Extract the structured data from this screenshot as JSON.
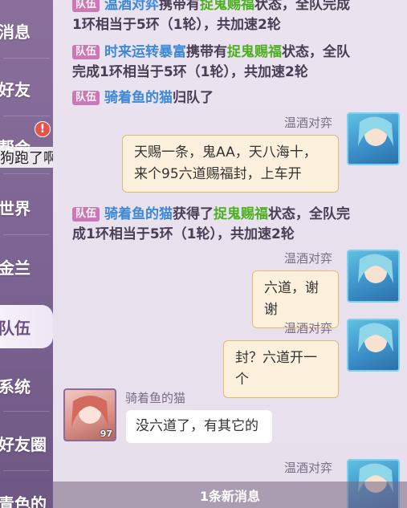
{
  "sidebar": {
    "items": [
      {
        "label": "消息"
      },
      {
        "label": "好友"
      },
      {
        "label": "帮会"
      },
      {
        "label": "世界"
      },
      {
        "label": "金兰"
      },
      {
        "label": "队伍"
      },
      {
        "label": "系统"
      },
      {
        "label": "好友圈"
      },
      {
        "label": "青色的"
      }
    ],
    "active": "队伍",
    "badge": "!",
    "overlay_text": "狗跑了啊"
  },
  "chat": {
    "sys1": {
      "tag": "队伍",
      "name": "温酒对弈",
      "pre": "携带有",
      "buff": "捉鬼赐福",
      "post": "状态，全队完成",
      "line2": "1环相当于5环（1轮），共加速2轮"
    },
    "sys2": {
      "tag": "队伍",
      "name": "时来运转暴富",
      "pre": "携带有",
      "buff": "捉鬼赐福",
      "post": "状态，全队",
      "line2": "完成1环相当于5环（1轮），共加速2轮"
    },
    "sys3": {
      "tag": "队伍",
      "name": "骑着鱼的猫",
      "post": "归队了"
    },
    "msg1": {
      "sender": "温酒对弈",
      "line1": "天赐一条，鬼AA，天八海十，",
      "line2": "来个95六道赐福封，上车开"
    },
    "sys4": {
      "tag": "队伍",
      "name": "骑着鱼的猫",
      "pre": "获得了",
      "buff": "捉鬼赐福",
      "post": "状态，全队完",
      "line2": "成1环相当于5环（1轮），共加速2轮"
    },
    "msg2": {
      "sender": "温酒对弈",
      "text": "六道，谢谢"
    },
    "msg3": {
      "sender": "温酒对弈",
      "text": "封？六道开一个"
    },
    "msg4": {
      "sender": "骑着鱼的猫",
      "text": "没六道了，有其它的",
      "level": "97"
    },
    "msg5": {
      "sender": "温酒对弈"
    }
  },
  "new_messages": "1条新消息",
  "colors": {
    "tag": "#cc77b6",
    "name_blue": "#3c89d6",
    "buff_green": "#4bb01f",
    "bubble_border": "#e8b870"
  }
}
